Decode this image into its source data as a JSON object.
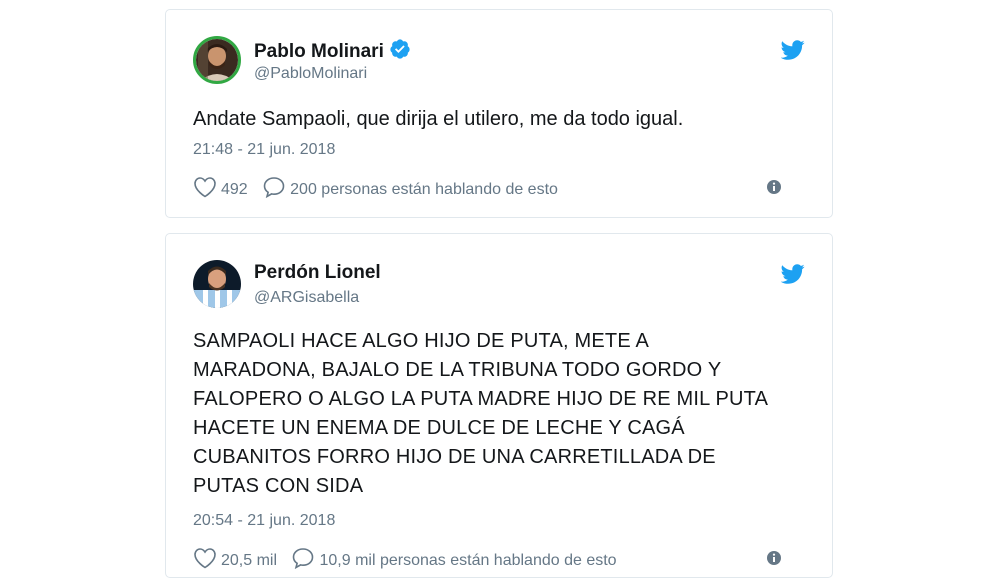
{
  "colors": {
    "accent": "#1da1f2",
    "text": "#14171a",
    "secondary": "#657786",
    "border": "#e1e8ed",
    "avatar_ring_green": "#31a843"
  },
  "tweets": [
    {
      "author": {
        "name": "Pablo Molinari",
        "handle": "@PabloMolinari",
        "verified": true,
        "avatar_icon": "avatar-photo"
      },
      "text": "Andate Sampaoli, que dirija el utilero, me da todo igual.",
      "timestamp": "21:48 - 21 jun. 2018",
      "likes": "492",
      "replies_text": "200 personas están hablando de esto",
      "icons": [
        "twitter-bird-icon",
        "heart-icon",
        "comment-icon",
        "info-icon"
      ]
    },
    {
      "author": {
        "name": "Perdón Lionel",
        "handle": "@ARGisabella",
        "verified": false,
        "avatar_icon": "avatar-photo"
      },
      "text": "SAMPAOLI HACE ALGO HIJO DE PUTA, METE A\nMARADONA, BAJALO DE LA TRIBUNA TODO GORDO Y\nFALOPERO O ALGO LA PUTA MADRE HIJO DE RE MIL PUTA\nHACETE UN ENEMA DE DULCE DE LECHE Y CAGÁ\nCUBANITOS FORRO HIJO DE UNA CARRETILLADA DE\nPUTAS CON SIDA",
      "timestamp": "20:54 - 21 jun. 2018",
      "likes": "20,5 mil",
      "replies_text": "10,9 mil personas están hablando de esto",
      "icons": [
        "twitter-bird-icon",
        "heart-icon",
        "comment-icon",
        "info-icon"
      ]
    }
  ]
}
